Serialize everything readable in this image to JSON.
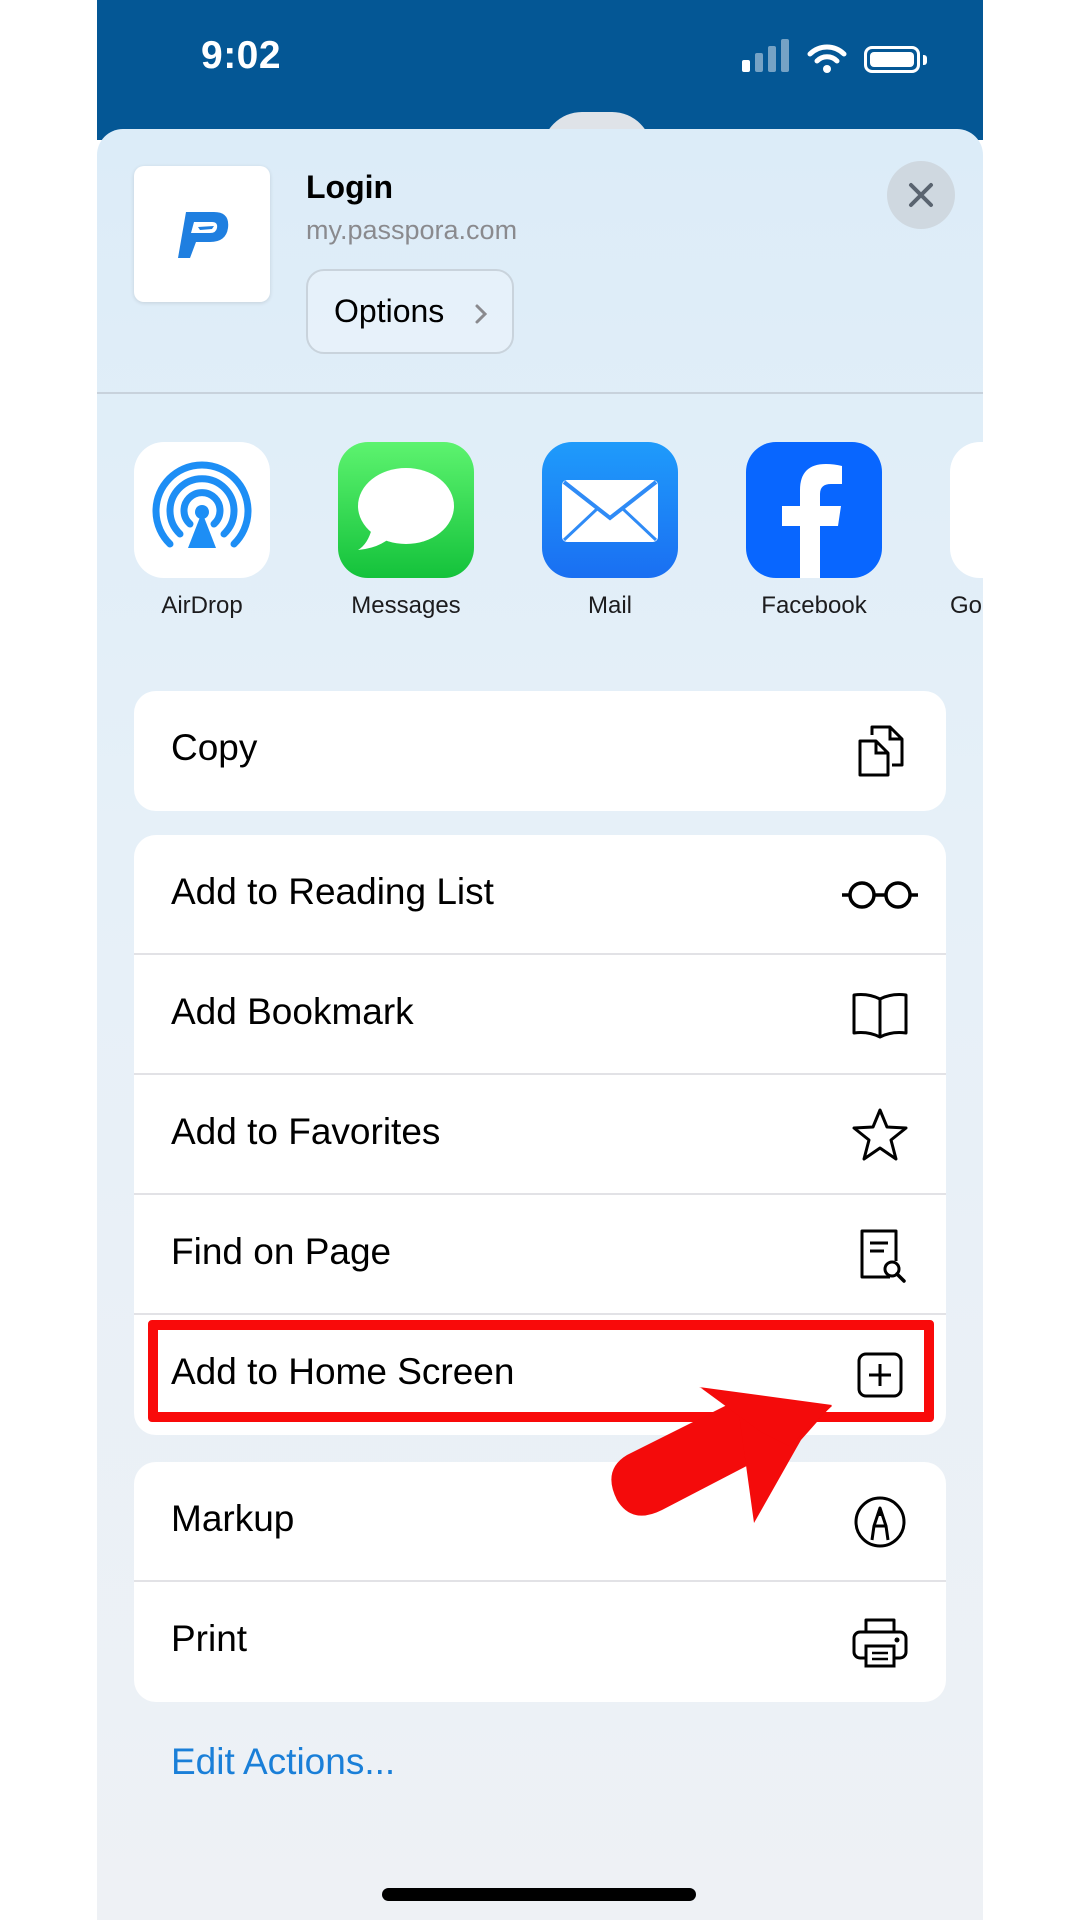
{
  "status_bar": {
    "time": "9:02",
    "background": "#045795"
  },
  "share_sheet": {
    "preview": {
      "title": "Login",
      "url": "my.passpora.com",
      "options_label": "Options",
      "icon": "passpora-logo-icon"
    },
    "close_icon": "close-icon",
    "apps": [
      {
        "label": "AirDrop",
        "icon": "airdrop-icon"
      },
      {
        "label": "Messages",
        "icon": "messages-icon"
      },
      {
        "label": "Mail",
        "icon": "mail-icon"
      },
      {
        "label": "Facebook",
        "icon": "facebook-icon"
      },
      {
        "label": "Goc",
        "icon": "google-icon"
      }
    ],
    "actions_group_1": [
      {
        "label": "Copy",
        "icon": "copy-icon"
      }
    ],
    "actions_group_2": [
      {
        "label": "Add to Reading List",
        "icon": "glasses-icon"
      },
      {
        "label": "Add Bookmark",
        "icon": "book-icon"
      },
      {
        "label": "Add to Favorites",
        "icon": "star-icon"
      },
      {
        "label": "Find on Page",
        "icon": "find-document-icon"
      },
      {
        "label": "Add to Home Screen",
        "icon": "plus-square-icon"
      }
    ],
    "actions_group_3": [
      {
        "label": "Markup",
        "icon": "markup-pen-icon"
      },
      {
        "label": "Print",
        "icon": "printer-icon"
      }
    ],
    "edit_actions_label": "Edit Actions...",
    "link_color": "#1a7fd8"
  },
  "annotation": {
    "highlight_color": "#f90a0a",
    "highlighted_item": "Add to Home Screen"
  }
}
